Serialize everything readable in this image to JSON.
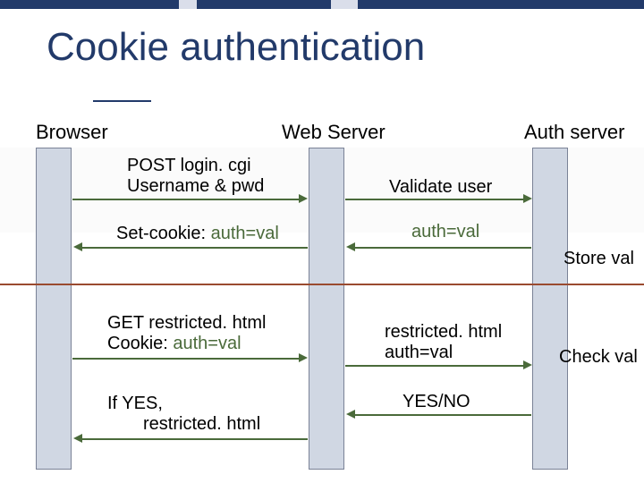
{
  "title": "Cookie authentication",
  "lanes": {
    "browser": "Browser",
    "web": "Web Server",
    "auth": "Auth server"
  },
  "messages": {
    "m1": {
      "line1": "POST login. cgi",
      "line2": "Username & pwd"
    },
    "m2": {
      "text": "Validate user"
    },
    "m3": {
      "prefix": "Set-cookie: ",
      "val": "auth=val"
    },
    "m4": {
      "val": "auth=val"
    },
    "m5": {
      "line1": "GET restricted. html",
      "line2_prefix": "Cookie: ",
      "line2_val": "auth=val"
    },
    "m6": {
      "line1": "restricted. html",
      "line2": "auth=val"
    },
    "m7": {
      "line1": "If YES,",
      "line2": "restricted. html"
    },
    "m8": {
      "text": "YES/NO"
    }
  },
  "sidenotes": {
    "store": "Store val",
    "check": "Check val"
  }
}
